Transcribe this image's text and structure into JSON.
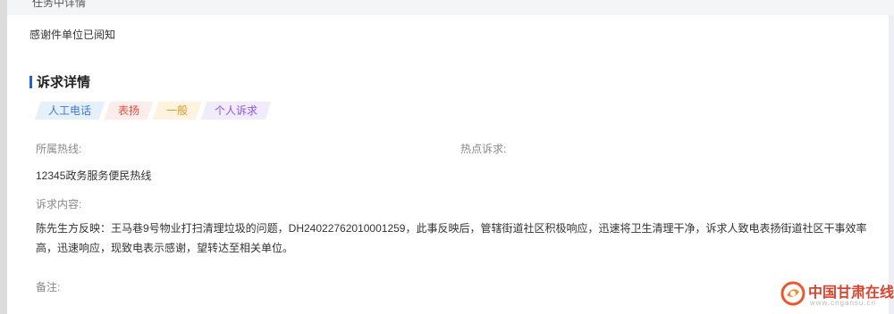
{
  "top_strip": {
    "text": "任务中详情"
  },
  "message": "感谢件单位已阅知",
  "section": {
    "title": "诉求详情"
  },
  "tags": [
    "人工电话",
    "表扬",
    "一般",
    "个人诉求"
  ],
  "fields": {
    "hotline_label": "所属热线:",
    "hotline_value": "12345政务服务便民热线",
    "hotspot_label": "热点诉求:",
    "content_label": "诉求内容:",
    "content_value": "陈先生方反映：王马巷9号物业打扫清理垃圾的问题，DH24022762010001259，此事反映后，管辖街道社区积极响应，迅速将卫生清理干净，诉求人致电表扬街道社区干事效率高，迅速响应，现致电表示感谢，望转达至相关单位。",
    "remark_label": "备注:"
  },
  "watermark": {
    "name": "中国甘肃在线",
    "url": "www.cngansu.cn"
  },
  "colors": {
    "accent": "#1f63d9",
    "tag_blue": "#3b7ad0",
    "tag_red": "#e0503e",
    "tag_yellow": "#d79a2a",
    "tag_purple": "#8a5ad1",
    "watermark": "#d9442e"
  }
}
